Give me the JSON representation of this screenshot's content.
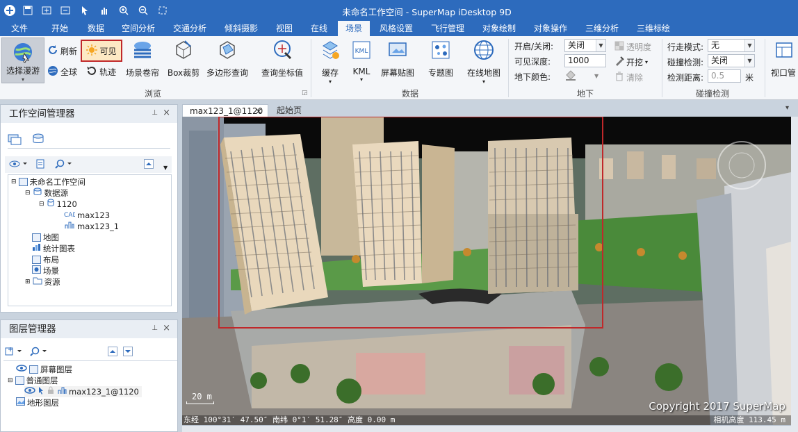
{
  "app": {
    "title": "未命名工作空间 - SuperMap iDesktop 9D"
  },
  "quick_access": [
    "file-icon",
    "save-icon",
    "open-icon",
    "import-icon",
    "select-icon",
    "pan-icon",
    "zoom-in-icon",
    "zoom-out-icon",
    "fit-icon"
  ],
  "menu_tabs": [
    "文件",
    "开始",
    "数据",
    "空间分析",
    "交通分析",
    "倾斜摄影",
    "视图",
    "在线",
    "场景",
    "风格设置",
    "飞行管理",
    "对象绘制",
    "对象操作",
    "三维分析",
    "三维标绘"
  ],
  "active_tab": "场景",
  "ribbon": {
    "browse": {
      "select_roam": "选择漫游",
      "refresh": "刷新",
      "visible": "可见",
      "globe": "全球",
      "track": "轨迹",
      "scene_curtain": "场景卷帘",
      "box_clip": "Box裁剪",
      "polygon_query": "多边形查询",
      "query_coord": "查询坐标值",
      "group": "浏览"
    },
    "data": {
      "cache": "缓存",
      "kml": "KML",
      "screen_paste": "屏幕贴图",
      "thematic": "专题图",
      "online_map": "在线地图",
      "group": "数据"
    },
    "underground": {
      "onoff_label": "开启/关闭:",
      "onoff_value": "关闭",
      "visible_depth_label": "可见深度:",
      "visible_depth_value": "1000",
      "ground_color_label": "地下颜色:",
      "transparency": "透明度",
      "dig": "开挖",
      "clear": "清除",
      "group": "地下"
    },
    "collision": {
      "walk_mode_label": "行走模式:",
      "walk_mode_value": "无",
      "collision_label": "碰撞检测:",
      "collision_value": "关闭",
      "distance_label": "检测距离:",
      "distance_value": "0.5",
      "distance_unit": "米",
      "group": "碰撞检测"
    },
    "view_window": "视口管"
  },
  "workspace_panel": {
    "title": "工作空间管理器",
    "nodes": [
      "未命名工作空间",
      "数据源",
      "1120",
      "max123",
      "max123_1",
      "地图",
      "统计图表",
      "布局",
      "场景",
      "资源"
    ]
  },
  "layer_panel": {
    "title": "图层管理器",
    "nodes": [
      "屏幕图层",
      "普通图层",
      "max123_1@1120",
      "地形图层"
    ]
  },
  "doc_tabs": {
    "active": "max123_1@1120",
    "other": "起始页",
    "close": "×"
  },
  "scene": {
    "copyright": "Copyright 2017 SuperMap",
    "scale": "20 m",
    "status_coords": "东经 100°31′ 47.50″ 南纬 0°1′ 51.28″ 高度 0.00 m",
    "camera_height": "相机高度 113.45 m"
  },
  "colors": {
    "title_blue": "#2d6bbd",
    "highlight_red": "#c0282a",
    "ribbon_bg": "#f4f6f9"
  }
}
